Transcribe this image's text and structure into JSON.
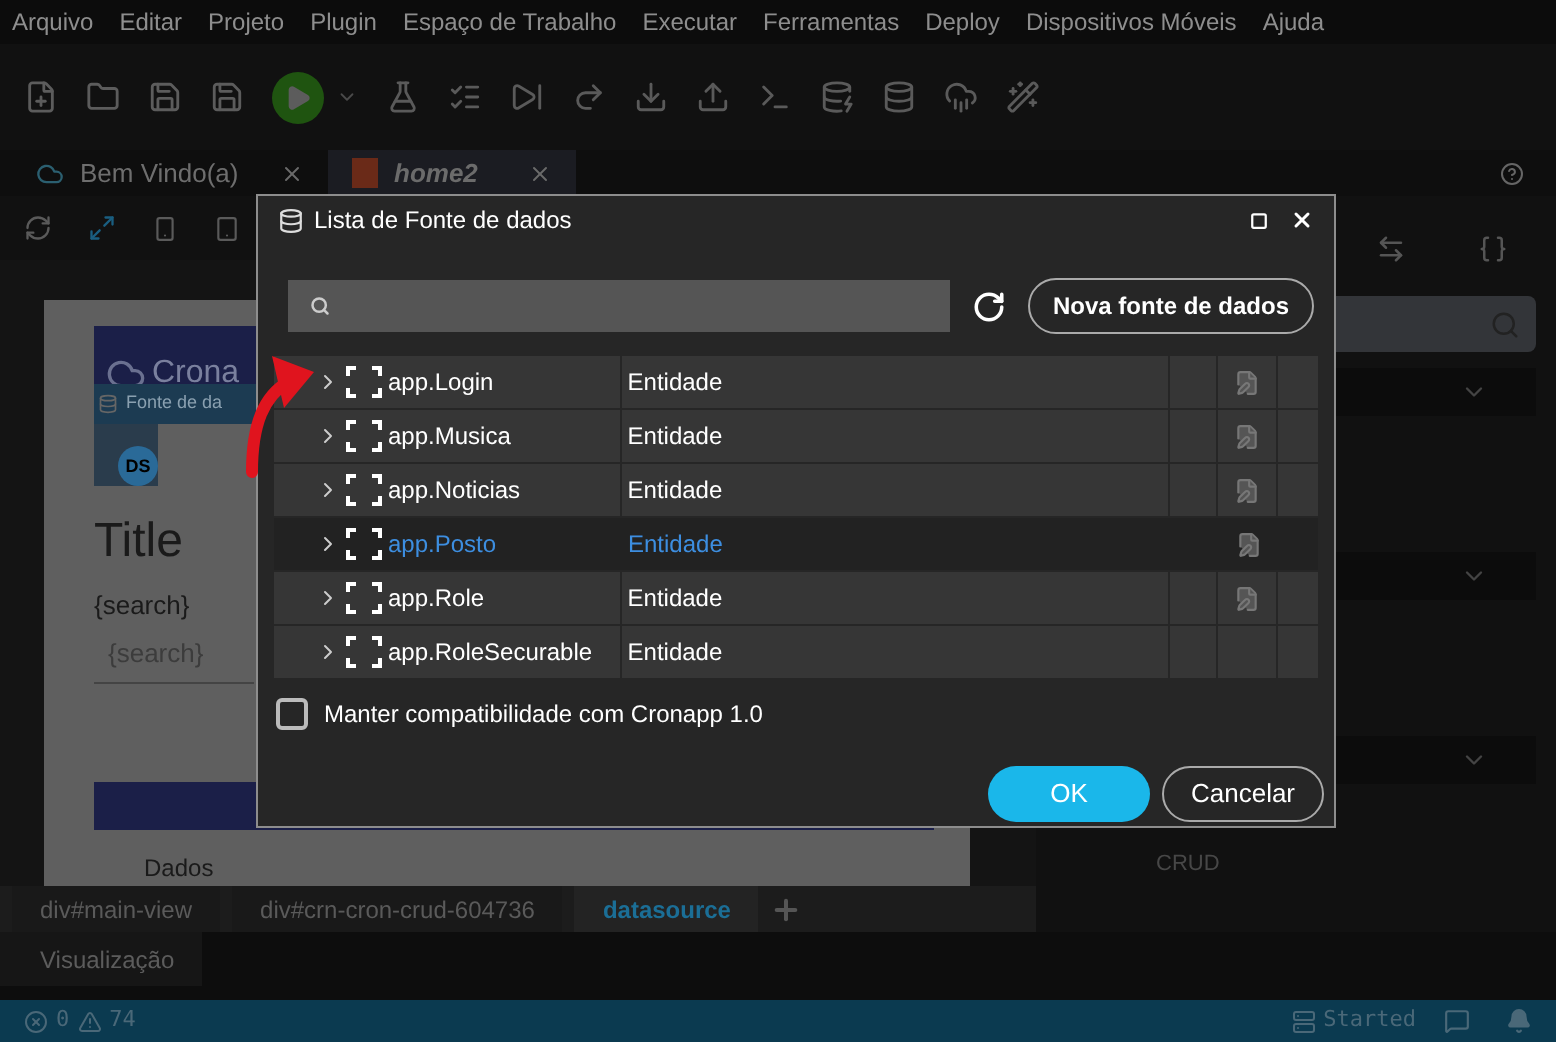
{
  "menu": [
    "Arquivo",
    "Editar",
    "Projeto",
    "Plugin",
    "Espaço de Trabalho",
    "Executar",
    "Ferramentas",
    "Deploy",
    "Dispositivos Móveis",
    "Ajuda"
  ],
  "tabs": [
    {
      "label": "Bem Vindo(a)",
      "selected": false,
      "kind": "cloud"
    },
    {
      "label": "home2",
      "selected": true,
      "kind": "html"
    }
  ],
  "preview": {
    "logo": "Crona",
    "datasource_label": "Fonte de da",
    "datasource_badge": "DS",
    "title": "Title",
    "search_label": "{search}",
    "search_placeholder": "{search}",
    "section": "Dados"
  },
  "right_panel": {
    "footer": "CRUD"
  },
  "breadcrumbs": [
    {
      "label": "div#main-view",
      "selected": false
    },
    {
      "label": "div#crn-cron-crud-604736",
      "selected": false
    },
    {
      "label": "datasource",
      "selected": true
    }
  ],
  "bottom_tab": "Visualização",
  "status_bar": {
    "errors": "0",
    "warnings": "74",
    "server": "Started"
  },
  "dialog": {
    "title": "Lista de Fonte de dados",
    "new_button": "Nova fonte de dados",
    "rows": [
      {
        "name": "app.Login",
        "type": "Entidade",
        "selected": false,
        "editable": true
      },
      {
        "name": "app.Musica",
        "type": "Entidade",
        "selected": false,
        "editable": true
      },
      {
        "name": "app.Noticias",
        "type": "Entidade",
        "selected": false,
        "editable": true
      },
      {
        "name": "app.Posto",
        "type": "Entidade",
        "selected": true,
        "editable": true
      },
      {
        "name": "app.Role",
        "type": "Entidade",
        "selected": false,
        "editable": true
      },
      {
        "name": "app.RoleSecurable",
        "type": "Entidade",
        "selected": false,
        "editable": false
      }
    ],
    "compat": {
      "label": "Manter compatibilidade com Cronapp 1.0",
      "checked": false
    },
    "ok": "OK",
    "cancel": "Cancelar"
  }
}
